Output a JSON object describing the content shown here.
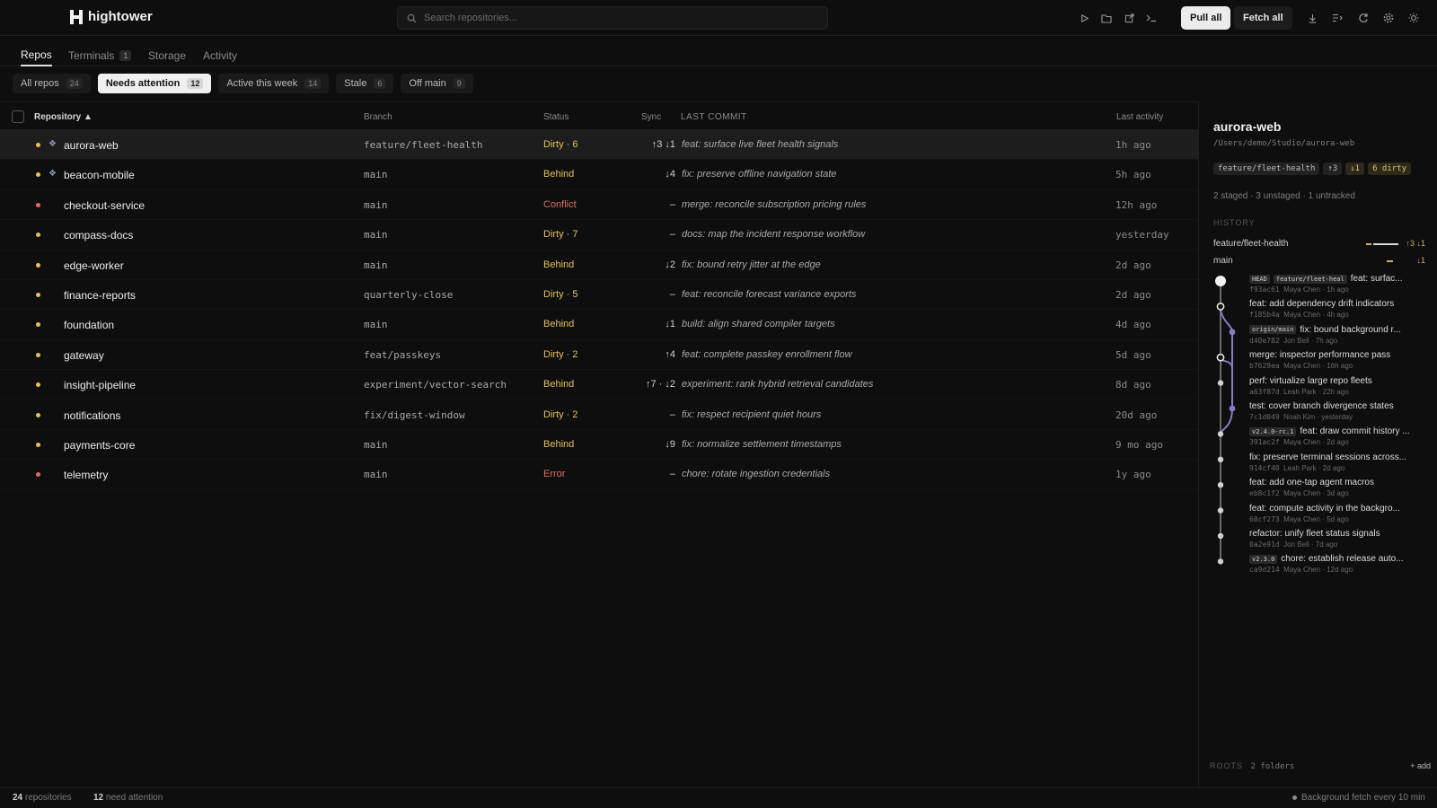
{
  "app": {
    "name": "hightower"
  },
  "search": {
    "placeholder": "Search repositories..."
  },
  "toolbar": {
    "pull_all": "Pull all",
    "fetch_all": "Fetch all"
  },
  "tabs": [
    {
      "label": "Repos",
      "badge": ""
    },
    {
      "label": "Terminals",
      "badge": "1"
    },
    {
      "label": "Storage",
      "badge": ""
    },
    {
      "label": "Activity",
      "badge": ""
    }
  ],
  "filters": [
    {
      "label": "All repos",
      "count": "24"
    },
    {
      "label": "Needs attention",
      "count": "12"
    },
    {
      "label": "Active this week",
      "count": "14"
    },
    {
      "label": "Stale",
      "count": "6"
    },
    {
      "label": "Off main",
      "count": "9"
    }
  ],
  "table": {
    "headers": {
      "repository": "Repository ▲",
      "branch": "Branch",
      "status": "Status",
      "sync": "Sync",
      "commit": "LAST COMMIT",
      "activity": "Last activity"
    },
    "rows": [
      {
        "name": "aurora-web",
        "pinned": true,
        "dot": "#e6c15a",
        "branch": "feature/fleet-health",
        "status": "Dirty · 6",
        "status_color": "#e3c15c",
        "sync": "↑3 ↓1",
        "commit": "feat: surface live fleet health signals",
        "time": "1h ago"
      },
      {
        "name": "beacon-mobile",
        "pinned": true,
        "dot": "#e6c15a",
        "branch": "main",
        "status": "Behind",
        "status_color": "#e3c15c",
        "sync": "↓4",
        "commit": "fix: preserve offline navigation state",
        "time": "5h ago"
      },
      {
        "name": "checkout-service",
        "pinned": false,
        "dot": "#e26b5e",
        "branch": "main",
        "status": "Conflict",
        "status_color": "#e07060",
        "sync": "–",
        "commit": "merge: reconcile subscription pricing rules",
        "time": "12h ago"
      },
      {
        "name": "compass-docs",
        "pinned": false,
        "dot": "#e6c15a",
        "branch": "main",
        "status": "Dirty · 7",
        "status_color": "#e3c15c",
        "sync": "–",
        "commit": "docs: map the incident response workflow",
        "time": "yesterday"
      },
      {
        "name": "edge-worker",
        "pinned": false,
        "dot": "#e6c15a",
        "branch": "main",
        "status": "Behind",
        "status_color": "#e3c15c",
        "sync": "↓2",
        "commit": "fix: bound retry jitter at the edge",
        "time": "2d ago"
      },
      {
        "name": "finance-reports",
        "pinned": false,
        "dot": "#e6c15a",
        "branch": "quarterly-close",
        "status": "Dirty · 5",
        "status_color": "#e3c15c",
        "sync": "–",
        "commit": "feat: reconcile forecast variance exports",
        "time": "2d ago"
      },
      {
        "name": "foundation",
        "pinned": false,
        "dot": "#e6c15a",
        "branch": "main",
        "status": "Behind",
        "status_color": "#e3c15c",
        "sync": "↓1",
        "commit": "build: align shared compiler targets",
        "time": "4d ago"
      },
      {
        "name": "gateway",
        "pinned": false,
        "dot": "#e6c15a",
        "branch": "feat/passkeys",
        "status": "Dirty · 2",
        "status_color": "#e3c15c",
        "sync": "↑4",
        "commit": "feat: complete passkey enrollment flow",
        "time": "5d ago"
      },
      {
        "name": "insight-pipeline",
        "pinned": false,
        "dot": "#e6c15a",
        "branch": "experiment/vector-search",
        "status": "Behind",
        "status_color": "#e3c15c",
        "sync": "↑7 · ↓2",
        "commit": "experiment: rank hybrid retrieval candidates",
        "time": "8d ago"
      },
      {
        "name": "notifications",
        "pinned": false,
        "dot": "#e6c15a",
        "branch": "fix/digest-window",
        "status": "Dirty · 2",
        "status_color": "#e3c15c",
        "sync": "–",
        "commit": "fix: respect recipient quiet hours",
        "time": "20d ago"
      },
      {
        "name": "payments-core",
        "pinned": false,
        "dot": "#e6c15a",
        "branch": "main",
        "status": "Behind",
        "status_color": "#e3c15c",
        "sync": "↓9",
        "commit": "fix: normalize settlement timestamps",
        "time": "9 mo ago"
      },
      {
        "name": "telemetry",
        "pinned": false,
        "dot": "#e26b5e",
        "branch": "main",
        "status": "Error",
        "status_color": "#e07060",
        "sync": "–",
        "commit": "chore: rotate ingestion credentials",
        "time": "1y ago"
      }
    ]
  },
  "panel": {
    "title": "aurora-web",
    "path": "/Users/demo/Studio/aurora-web",
    "tags": [
      "feature/fleet-health",
      "↑3",
      "↓1",
      "6 dirty"
    ],
    "stage_summary": "2 staged · 3 unstaged · 1 untracked",
    "history_label": "HISTORY",
    "branches": [
      {
        "name": "feature/fleet-health",
        "sync": "↑3 ↓1"
      },
      {
        "name": "main",
        "sync": "↓1"
      }
    ],
    "commits": [
      {
        "refs": [
          "HEAD",
          "feature/fleet-heal"
        ],
        "msg": "feat: surfac...",
        "hash": "f93ac61",
        "author": "Maya Chen",
        "time": "1h ago"
      },
      {
        "refs": [],
        "msg": "feat: add dependency drift indicators",
        "hash": "f185b4a",
        "author": "Maya Chen",
        "time": "4h ago"
      },
      {
        "refs": [
          "origin/main"
        ],
        "msg": "fix: bound background r...",
        "hash": "d40e782",
        "author": "Jon Bell",
        "time": "7h ago"
      },
      {
        "refs": [],
        "msg": "merge: inspector performance pass",
        "hash": "b7629ea",
        "author": "Maya Chen",
        "time": "16h ago"
      },
      {
        "refs": [],
        "msg": "perf: virtualize large repo fleets",
        "hash": "a63f87d",
        "author": "Leah Park",
        "time": "22h ago"
      },
      {
        "refs": [],
        "msg": "test: cover branch divergence states",
        "hash": "7c1d049",
        "author": "Noah Kim",
        "time": "yesterday"
      },
      {
        "refs": [
          "v2.4.0-rc.1"
        ],
        "msg": "feat: draw commit history ...",
        "hash": "391ac2f",
        "author": "Maya Chen",
        "time": "2d ago"
      },
      {
        "refs": [],
        "msg": "fix: preserve terminal sessions across...",
        "hash": "914cf40",
        "author": "Leah Park",
        "time": "2d ago"
      },
      {
        "refs": [],
        "msg": "feat: add one-tap agent macros",
        "hash": "eb8c1f2",
        "author": "Maya Chen",
        "time": "3d ago"
      },
      {
        "refs": [],
        "msg": "feat: compute activity in the backgro...",
        "hash": "68cf273",
        "author": "Maya Chen",
        "time": "5d ago"
      },
      {
        "refs": [],
        "msg": "refactor: unify fleet status signals",
        "hash": "0a2e91d",
        "author": "Jon Bell",
        "time": "7d ago"
      },
      {
        "refs": [
          "v2.3.0"
        ],
        "msg": "chore: establish release auto...",
        "hash": "ca9d214",
        "author": "Maya Chen",
        "time": "12d ago"
      }
    ],
    "roots_label": "ROOTS",
    "roots_value": "2 folders",
    "add_label": "+ add"
  },
  "statusbar": {
    "repo_count": "24",
    "repo_label": "repositories",
    "attention_count": "12",
    "attention_label": "need attention",
    "fetch_info": "Background fetch every 10 min"
  }
}
